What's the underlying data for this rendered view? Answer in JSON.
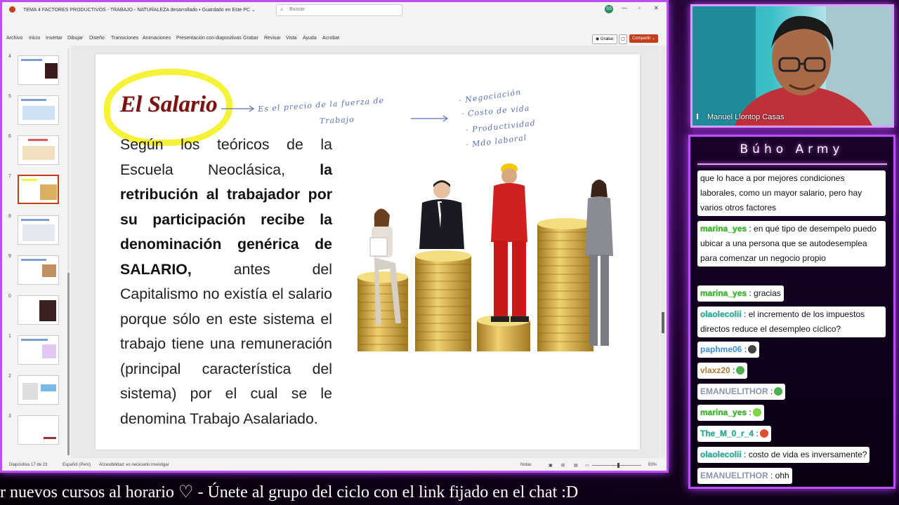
{
  "window": {
    "doc_title": "TEMA 4 FACTORES PRODUCTIVOS - TRABAJO - NATURALEZA desarrollado • Guardado en Este PC ⌄",
    "search_placeholder": "Buscar",
    "user_initials": "SS",
    "min": "—",
    "max": "▫",
    "close": "✕"
  },
  "menu": {
    "items": [
      "Archivo",
      "Inicio",
      "Insertar",
      "Dibujar",
      "Diseño",
      "Transiciones",
      "Animaciones",
      "Presentación con diapositivas",
      "Grabar",
      "Revisar",
      "Vista",
      "Ayuda",
      "Acrobat"
    ],
    "grabar": "◉ Grabar",
    "comments": "▢",
    "share": "Compartir ⌄"
  },
  "thumbnails": [
    {
      "num": "4"
    },
    {
      "num": "5"
    },
    {
      "num": "6"
    },
    {
      "num": "7"
    },
    {
      "num": "8"
    },
    {
      "num": "9"
    },
    {
      "num": "0"
    },
    {
      "num": "1"
    },
    {
      "num": "2"
    },
    {
      "num": "3"
    }
  ],
  "status": {
    "slide_count": "Diapositiva 17 de 23",
    "language": "Español (Perú)",
    "accessibility": "Accesibilidad: es necesario investigar",
    "notes": "Notas",
    "zoom": "83%"
  },
  "slide": {
    "title": "El Salario",
    "annotation_line1": "Es el precio de la fuerza de",
    "annotation_line2": "Trabajo",
    "annotation_list": [
      "· Negociación",
      "· Costo de vida",
      "· Productividad",
      "· Mdo laboral"
    ],
    "body_p1": "Según los teóricos de la Escuela Neoclásica, ",
    "body_bold": "la retribución al trabajador por su participación recibe la denominación genérica de SALARIO,",
    "body_p2": " antes del Capitalismo no existía el salario porque sólo en este sistema el trabajo tiene una remuneración (principal característica del sistema) por el cual se le denomina Trabajo Asalariado."
  },
  "webcam": {
    "name": "Manuel Llontop Casas"
  },
  "chat": {
    "title": "Búho Army",
    "messages": [
      {
        "user": "",
        "text": "que lo hace a por mejores condiciones laborales, como un mayor salario, pero hay varios otros factores"
      },
      {
        "user": "marina_yes",
        "text": ": en qué tipo de desempelo puedo ubicar a una persona que se autodesemplea para comenzar un negocio propio"
      },
      {
        "user": "marina_yes",
        "text": ": gracias"
      },
      {
        "user": "olaolecolii",
        "text": ": el incremento de los impuestos directos reduce el desempleo cíclico?"
      },
      {
        "user": "paphme06",
        "text": ":"
      },
      {
        "user": "vlaxz20",
        "text": ":"
      },
      {
        "user": "EMANUELITHOR",
        "text": ":"
      },
      {
        "user": "marina_yes",
        "text": ":"
      },
      {
        "user": "The_M_0_r_4",
        "text": ":"
      },
      {
        "user": "olaolecolii",
        "text": ": costo de vida es inversamente?"
      },
      {
        "user": "EMANUELITHOR",
        "text": ": ohh"
      }
    ]
  },
  "ticker": {
    "text": "r nuevos cursos al horario  ♡   -  Únete al grupo del ciclo con el link fijado en el chat :D"
  },
  "colors": {
    "frame": "#c04cff",
    "title_red": "#7a1010",
    "highlight": "#f6f23a",
    "share_btn": "#c43e1c"
  }
}
